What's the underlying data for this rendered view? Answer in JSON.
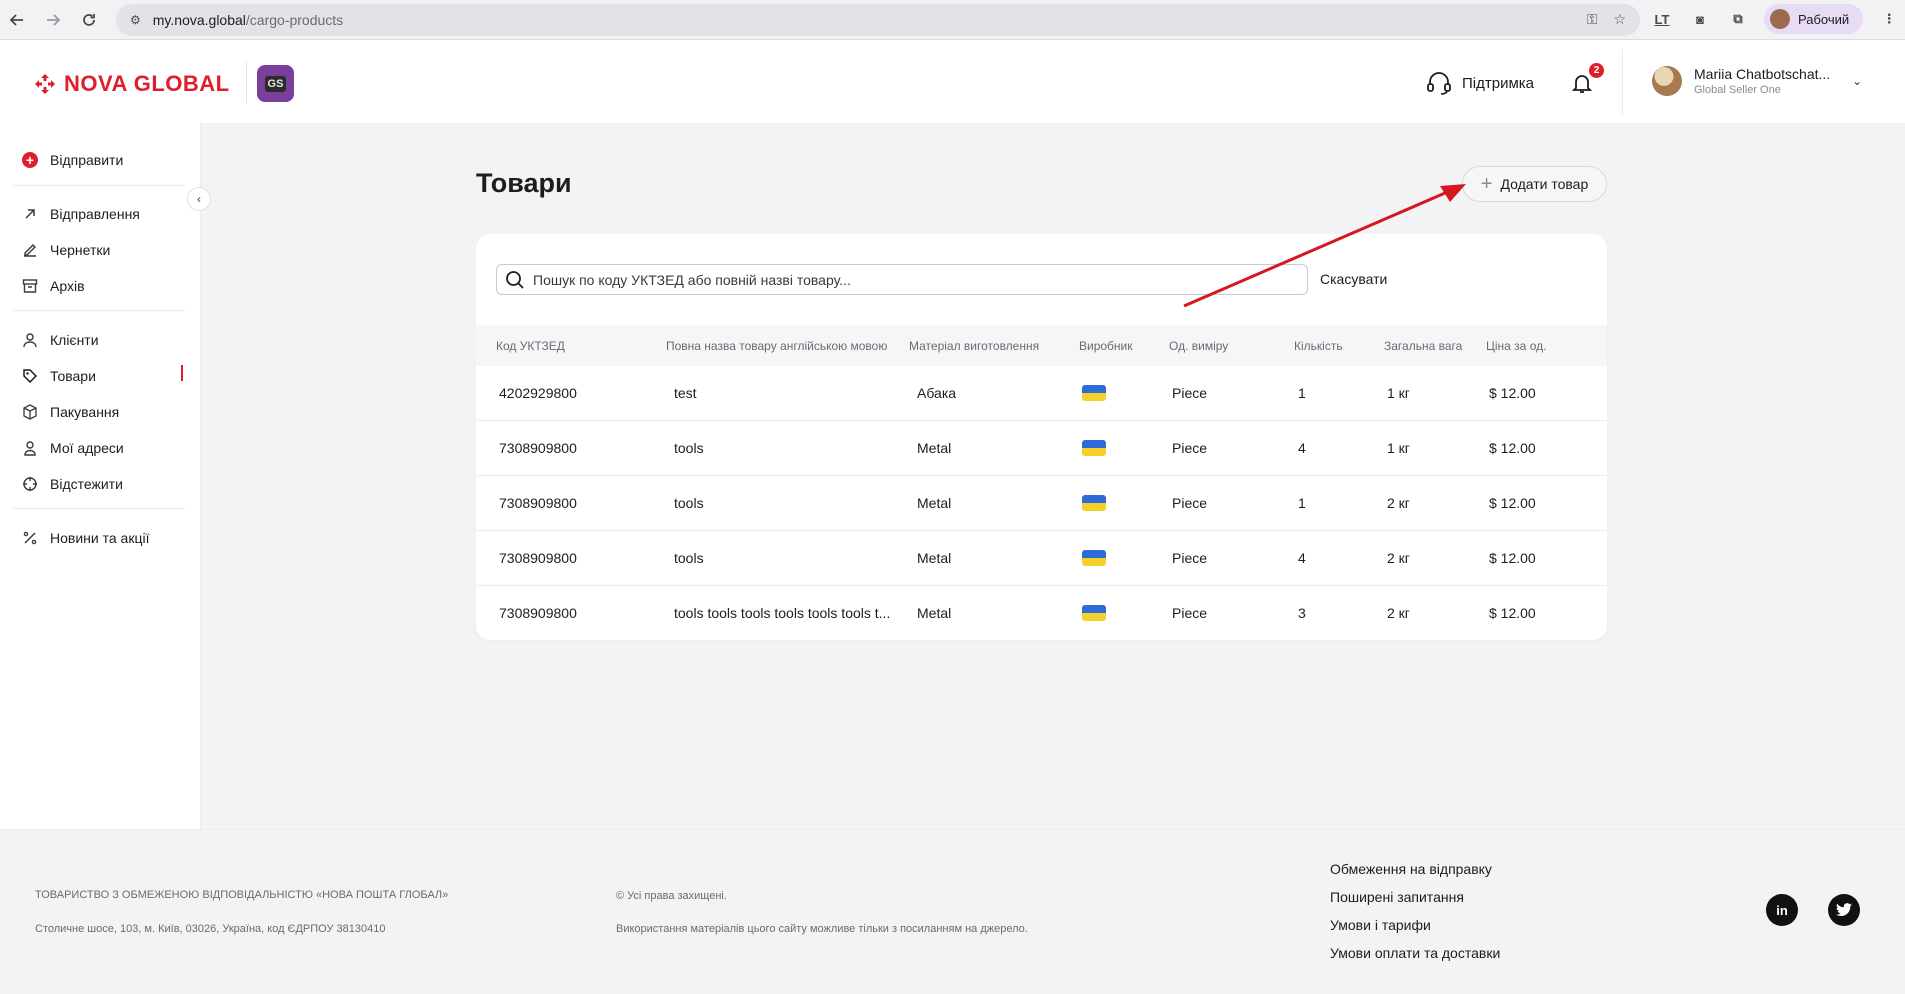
{
  "browser": {
    "url_host": "my.nova.global",
    "url_path": "/cargo-products",
    "profile_label": "Рабочий",
    "ext_label": "LT"
  },
  "header": {
    "logo_text": "NOVA GLOBAL",
    "badge_text": "GS",
    "support_label": "Підтримка",
    "notifications_count": "2",
    "user_name": "Mariia Chatbotschat...",
    "user_role": "Global Seller One"
  },
  "sidebar": {
    "send_label": "Відправити",
    "items": [
      {
        "label": "Відправлення",
        "icon": "arrow-up-right-icon"
      },
      {
        "label": "Чернетки",
        "icon": "edit-icon"
      },
      {
        "label": "Архів",
        "icon": "archive-icon"
      },
      {
        "label": "Клієнти",
        "icon": "users-icon"
      },
      {
        "label": "Товари",
        "icon": "tag-icon",
        "active": true
      },
      {
        "label": "Пакування",
        "icon": "box-icon"
      },
      {
        "label": "Мої адреси",
        "icon": "address-icon"
      },
      {
        "label": "Відстежити",
        "icon": "crosshair-icon"
      },
      {
        "label": "Новини та акції",
        "icon": "percent-icon"
      }
    ]
  },
  "page": {
    "title": "Товари",
    "add_button_label": "Додати товар",
    "search_placeholder": "Пошук по коду УКТЗЕД або повній назві товару...",
    "cancel_label": "Скасувати"
  },
  "table": {
    "headers": [
      "Код УКТЗЕД",
      "Повна назва товару англійською мовою",
      "Матеріал виготовлення",
      "Виробник",
      "Од. виміру",
      "Кількість",
      "Загальна вага",
      "Ціна за од."
    ],
    "rows": [
      {
        "code": "4202929800",
        "name": "test",
        "material": "Абака",
        "manufacturer": "ukraine-flag",
        "unit": "Piece",
        "qty": "1",
        "weight": "1 кг",
        "price": "$ 12.00"
      },
      {
        "code": "7308909800",
        "name": "tools",
        "material": "Metal",
        "manufacturer": "ukraine-flag",
        "unit": "Piece",
        "qty": "4",
        "weight": "1 кг",
        "price": "$ 12.00"
      },
      {
        "code": "7308909800",
        "name": "tools",
        "material": "Metal",
        "manufacturer": "ukraine-flag",
        "unit": "Piece",
        "qty": "1",
        "weight": "2 кг",
        "price": "$ 12.00"
      },
      {
        "code": "7308909800",
        "name": "tools",
        "material": "Metal",
        "manufacturer": "ukraine-flag",
        "unit": "Piece",
        "qty": "4",
        "weight": "2 кг",
        "price": "$ 12.00"
      },
      {
        "code": "7308909800",
        "name": "tools tools tools tools tools tools t...",
        "material": "Metal",
        "manufacturer": "ukraine-flag",
        "unit": "Piece",
        "qty": "3",
        "weight": "2 кг",
        "price": "$ 12.00"
      }
    ]
  },
  "footer": {
    "company": "ТОВАРИСТВО З ОБМЕЖЕНОЮ ВІДПОВІДАЛЬНІСТЮ «НОВА ПОШТА ГЛОБАЛ»",
    "address": "Столичне шосе, 103, м. Київ, 03026, Україна, код ЄДРПОУ 38130410",
    "rights": "© Усі права захищені.",
    "usage": "Використання матеріалів цього сайту можливе тільки з посиланням на джерело.",
    "links": [
      "Обмеження на відправку",
      "Поширені запитання",
      "Умови і тарифи",
      "Умови оплати та доставки"
    ],
    "social": [
      "linkedin-icon",
      "twitter-icon"
    ]
  },
  "colors": {
    "brand_red": "#e01e2b",
    "badge_purple": "#7a3f9a",
    "annotation_arrow": "#d6171f"
  }
}
